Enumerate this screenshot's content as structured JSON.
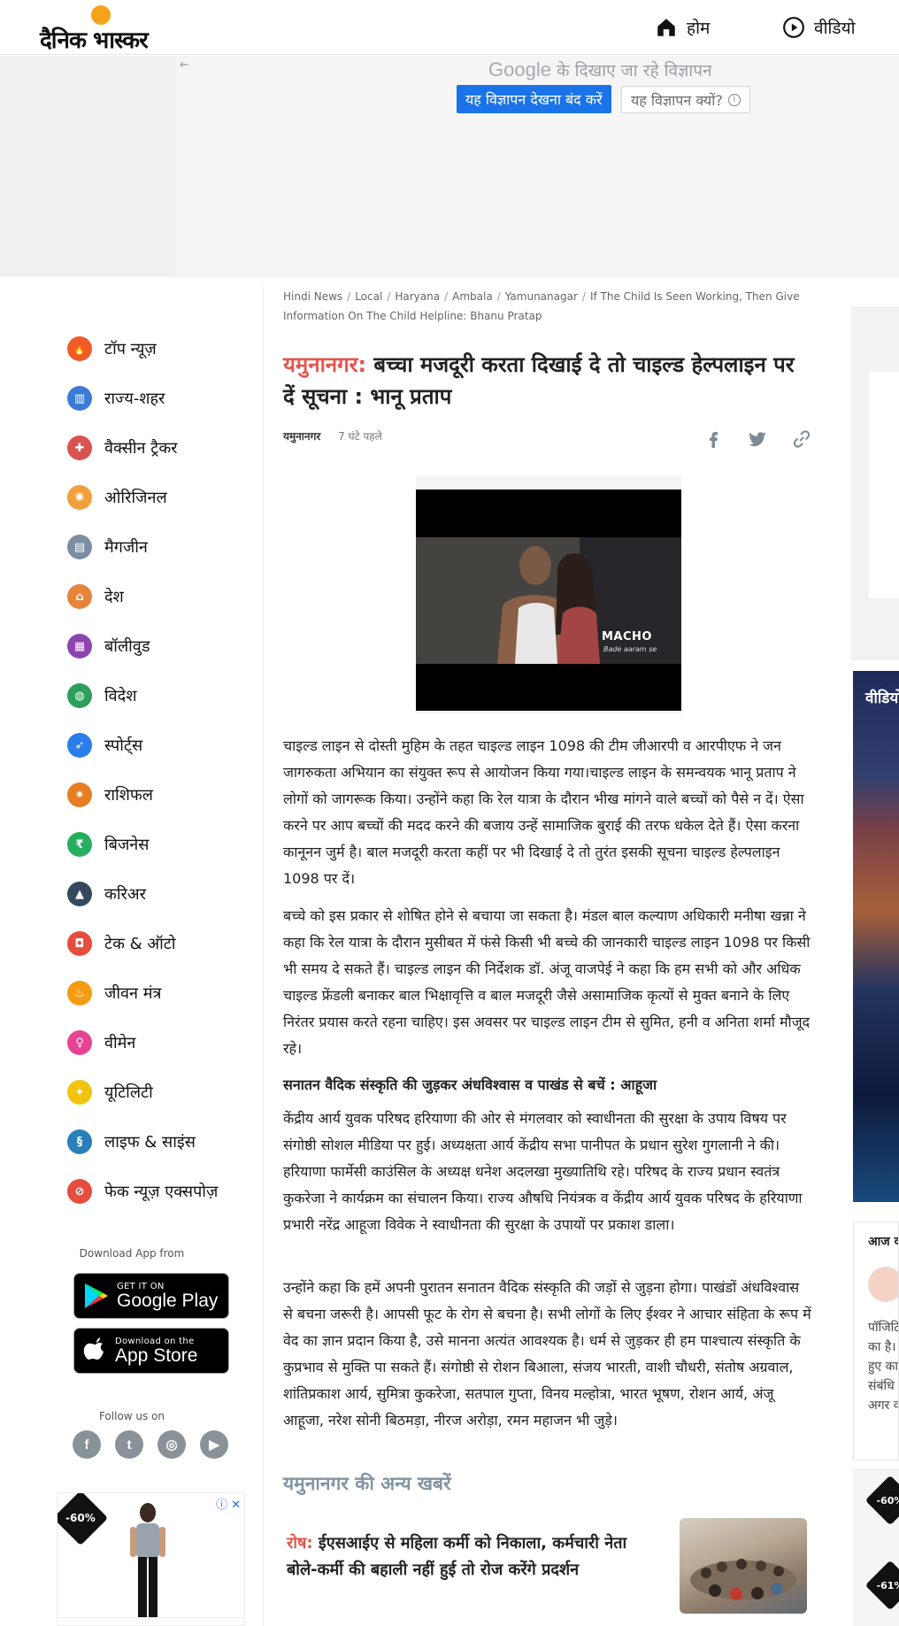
{
  "header": {
    "logo_text": "दैनिक भास्कर",
    "nav": [
      {
        "label": "होम",
        "icon": "home-icon"
      },
      {
        "label": "वीडियो",
        "icon": "play-circle-icon"
      }
    ]
  },
  "ad_banner": {
    "back_arrow": "←",
    "google_word": "Google",
    "google_suffix": "के दिखाए जा रहे विज्ञापन",
    "stop_button": "यह विज्ञापन देखना बंद करें",
    "why_button": "यह विज्ञापन क्यों?",
    "info_glyph": "i"
  },
  "sidebar": {
    "items": [
      {
        "label": "टॉप न्यूज़",
        "icon": "flame-icon",
        "color": "#f15a29",
        "glyph": "🔥"
      },
      {
        "label": "राज्य-शहर",
        "icon": "city-icon",
        "color": "#3a7bd5",
        "glyph": "▥"
      },
      {
        "label": "वैक्सीन ट्रैकर",
        "icon": "vaccine-icon",
        "color": "#d9534f",
        "glyph": "✚"
      },
      {
        "label": "ओरिजिनल",
        "icon": "original-icon",
        "color": "#f2a03d",
        "glyph": "✺"
      },
      {
        "label": "मैगजीन",
        "icon": "magazine-icon",
        "color": "#7b8ea3",
        "glyph": "▤"
      },
      {
        "label": "देश",
        "icon": "india-gate-icon",
        "color": "#e8833a",
        "glyph": "⌂"
      },
      {
        "label": "बॉलीवुड",
        "icon": "clapperboard-icon",
        "color": "#8e44ad",
        "glyph": "▦"
      },
      {
        "label": "विदेश",
        "icon": "globe-icon",
        "color": "#2e9e5b",
        "glyph": "◍"
      },
      {
        "label": "स्पोर्ट्स",
        "icon": "runner-icon",
        "color": "#2b7de9",
        "glyph": "➶"
      },
      {
        "label": "राशिफल",
        "icon": "zodiac-icon",
        "color": "#e67e22",
        "glyph": "✷"
      },
      {
        "label": "बिजनेस",
        "icon": "rupee-icon",
        "color": "#27ae60",
        "glyph": "₹"
      },
      {
        "label": "करिअर",
        "icon": "graduation-cap-icon",
        "color": "#34495e",
        "glyph": "▲"
      },
      {
        "label": "टेक & ऑटो",
        "icon": "car-phone-icon",
        "color": "#e74c3c",
        "glyph": "◘"
      },
      {
        "label": "जीवन मंत्र",
        "icon": "lamp-icon",
        "color": "#f39c12",
        "glyph": "♨"
      },
      {
        "label": "वीमेन",
        "icon": "women-icon",
        "color": "#e84393",
        "glyph": "♀"
      },
      {
        "label": "यूटिलिटी",
        "icon": "bulb-icon",
        "color": "#f1c40f",
        "glyph": "✦"
      },
      {
        "label": "लाइफ & साइंस",
        "icon": "dna-icon",
        "color": "#2980b9",
        "glyph": "§"
      },
      {
        "label": "फेक न्यूज़ एक्सपोज़",
        "icon": "fake-news-icon",
        "color": "#e74c3c",
        "glyph": "⊘"
      }
    ],
    "download_label": "Download App from",
    "google_play": {
      "small": "GET IT ON",
      "big": "Google Play"
    },
    "app_store": {
      "small": "Download on the",
      "big": "App Store"
    },
    "follow_label": "Follow us on",
    "socials": [
      {
        "name": "facebook-icon",
        "glyph": "f"
      },
      {
        "name": "twitter-icon",
        "glyph": "t"
      },
      {
        "name": "instagram-icon",
        "glyph": "◎"
      },
      {
        "name": "youtube-icon",
        "glyph": "▶"
      }
    ],
    "ad_tag": "-60%",
    "ad_close": "ⓘ ✕"
  },
  "article": {
    "breadcrumbs": [
      "Hindi News",
      "Local",
      "Haryana",
      "Ambala",
      "Yamunanagar",
      "If The Child Is Seen Working, Then Give Information On The Child Helpline: Bhanu Pratap"
    ],
    "headline_location": "यमुनानगर:",
    "headline_text": " बच्चा मजदूरी करता दिखाई दे तो चाइल्ड हेल्पलाइन पर दें सूचना : भानू प्रताप",
    "city": "यमुनानगर",
    "time": "7 घंटे पहले",
    "video_brand": "MACHO",
    "video_sub": "Bade aaram se",
    "paragraphs": [
      "चाइल्ड लाइन से दोस्ती मुहिम के तहत चाइल्ड लाइन 1098 की टीम जीआरपी व आरपीएफ ने जन जागरुकता अभियान का संयुक्त रूप से आयोजन किया गया।चाइल्ड लाइन के समन्वयक भानू प्रताप ने लोगों को जागरूक किया। उन्होंने कहा कि रेल यात्रा के दौरान भीख मांगने वाले बच्चों को पैसे न दें। ऐसा करने पर आप बच्चों की मदद करने की बजाय उन्हें सामाजिक बुराई की तरफ धकेल देते हैं। ऐसा करना कानूनन जुर्म है। बाल मजदूरी करता कहीं पर भी दिखाई दे तो तुरंत इसकी सूचना चाइल्ड हेल्पलाइन 1098 पर दें।",
      "बच्चे को इस प्रकार से शोषित होने से बचाया जा सकता है। मंडल बाल कल्याण अधिकारी मनीषा खन्ना ने कहा कि रेल यात्रा के दौरान मुसीबत में फंसे किसी भी बच्चे की जानकारी चाइल्ड लाइन 1098 पर किसी भी समय दे सकते हैं। चाइल्ड लाइन की निर्देशक डॉ. अंजू वाजपेई ने कहा कि हम सभी को और अधिक चाइल्ड फ्रेंडली बनाकर बाल भिक्षावृत्ति व बाल मजदूरी जैसे असामाजिक कृत्यों से मुक्त बनाने के लिए निरंतर प्रयास करते रहना चाहिए। इस अवसर पर चाइल्ड लाइन टीम से सुमित, हनी व अनिता शर्मा मौजूद रहे।",
      "सनातन वैदिक संस्कृति की जुड़कर अंधविश्वास व पाखंड से बचें : आहूजा",
      "केंद्रीय आर्य युवक परिषद हरियाणा की ओर से मंगलवार को स्वाधीनता की सुरक्षा के उपाय विषय पर संगोष्ठी सोशल मीडिया पर हुई। अध्यक्षता आर्य केंद्रीय सभा पानीपत के प्रधान सुरेश गुगलानी ने की। हरियाणा फार्मेसी काउंसिल के अध्यक्ष धनेश अदलखा मुख्यातिथि रहे। परिषद के राज्य प्रधान स्वतंत्र कुकरेजा ने कार्यक्रम का संचालन किया। राज्य औषधि नियंत्रक व केंद्रीय आर्य युवक परिषद के हरियाणा प्रभारी नरेंद्र आहूजा विवेक ने स्वाधीनता की सुरक्षा के उपायों पर प्रकाश डाला।",
      "उन्होंने कहा कि हमें अपनी पुरातन सनातन वैदिक संस्कृति की जड़ों से जुड़ना होगा। पाखंडों अंधविश्वास से बचना जरूरी है। आपसी फूट के रोग से बचना है। सभी लोगों के लिए ईश्वर ने आचार संहिता के रूप में वेद का ज्ञान प्रदान किया है, उसे मानना अत्यंत आवश्यक है। धर्म से जुड़कर ही हम पाश्चात्य संस्कृति के कुप्रभाव से मुक्ति पा सकते हैं। संगोष्ठी से रोशन बिआला, संजय भारती, वाशी चौधरी, संतोष अग्रवाल, शांतिप्रकाश आर्य, सुमित्रा कुकरेजा, सतपाल गुप्ता, विनय मल्होत्रा, भारत भूषण, रोशन आर्य, अंजू आहूजा, नरेश सोनी बिठमड़ा, नीरज अरोड़ा, रमन महाजन भी जुड़े।"
    ],
    "more_heading": "यमुनानगर की अन्य खबरें",
    "related": {
      "tag": "रोष:",
      "title": " ईएसआईए से महिला कर्मी को निकाला, कर्मचारी नेता बोले-कर्मी की बहाली नहीं हुई तो रोज करेंगे प्रदर्शन"
    }
  },
  "right_rail": {
    "video_title": "वीडियो",
    "today_heading": "आज का",
    "today_text": [
      "पॉजिटि",
      "का है।",
      "हुए का",
      "संबंधि",
      "अगर व"
    ],
    "ad_tag_1": "-60%",
    "ad_tag_2": "-61%"
  },
  "colors": {
    "accent_red": "#e4544f",
    "google_blue": "#1a73e8",
    "muted_heading": "#8294a1"
  }
}
